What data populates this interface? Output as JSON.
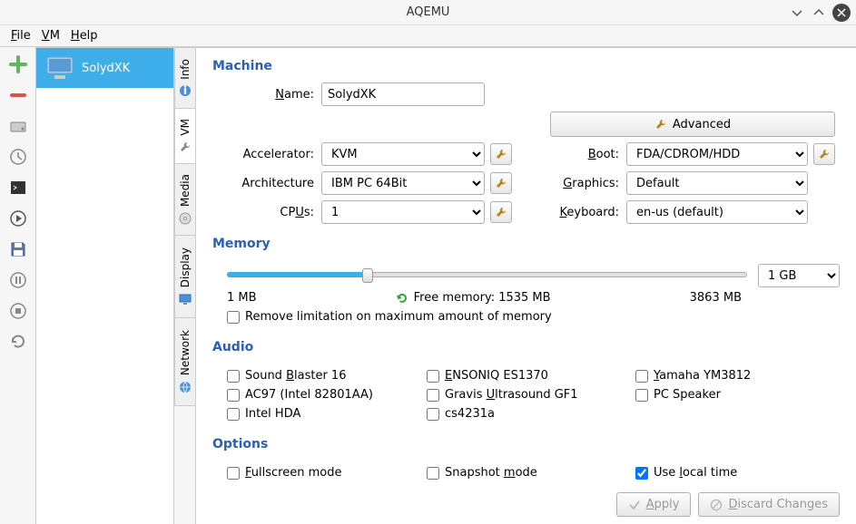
{
  "window": {
    "title": "AQEMU"
  },
  "menu": {
    "file": "File",
    "vm": "VM",
    "help": "Help"
  },
  "vmlist": {
    "items": [
      {
        "name": "SolydXK",
        "selected": true
      }
    ]
  },
  "vtabs": {
    "info": "Info",
    "vm": "VM",
    "media": "Media",
    "display": "Display",
    "network": "Network"
  },
  "machine": {
    "title": "Machine",
    "name_label": "Name:",
    "name_value": "SolydXK",
    "accel_label": "Accelerator:",
    "accel_value": "KVM",
    "arch_label": "Architecture",
    "arch_value": "IBM PC 64Bit",
    "cpus_label": "CPUs:",
    "cpus_value": "1",
    "boot_label": "Boot:",
    "boot_value": "FDA/CDROM/HDD",
    "graphics_label": "Graphics:",
    "graphics_value": "Default",
    "keyboard_label": "Keyboard:",
    "keyboard_value": "en-us (default)",
    "advanced": "Advanced"
  },
  "memory": {
    "title": "Memory",
    "min": "1 MB",
    "free": "Free memory: 1535 MB",
    "max": "3863 MB",
    "value": "1 GB",
    "remove_limit": "Remove limitation on maximum amount of memory"
  },
  "audio": {
    "title": "Audio",
    "sb16": "Sound Blaster 16",
    "ensoniq": "ENSONIQ ES1370",
    "yamaha": "Yamaha YM3812",
    "ac97": "AC97 (Intel 82801AA)",
    "gravis": "Gravis Ultrasound GF1",
    "pcspeaker": "PC Speaker",
    "intelhda": "Intel HDA",
    "cs4231a": "cs4231a"
  },
  "options": {
    "title": "Options",
    "fullscreen": "Fullscreen mode",
    "snapshot": "Snapshot mode",
    "localtime": "Use local time",
    "localtime_checked": true
  },
  "footer": {
    "apply": "Apply",
    "discard": "Discard Changes"
  }
}
